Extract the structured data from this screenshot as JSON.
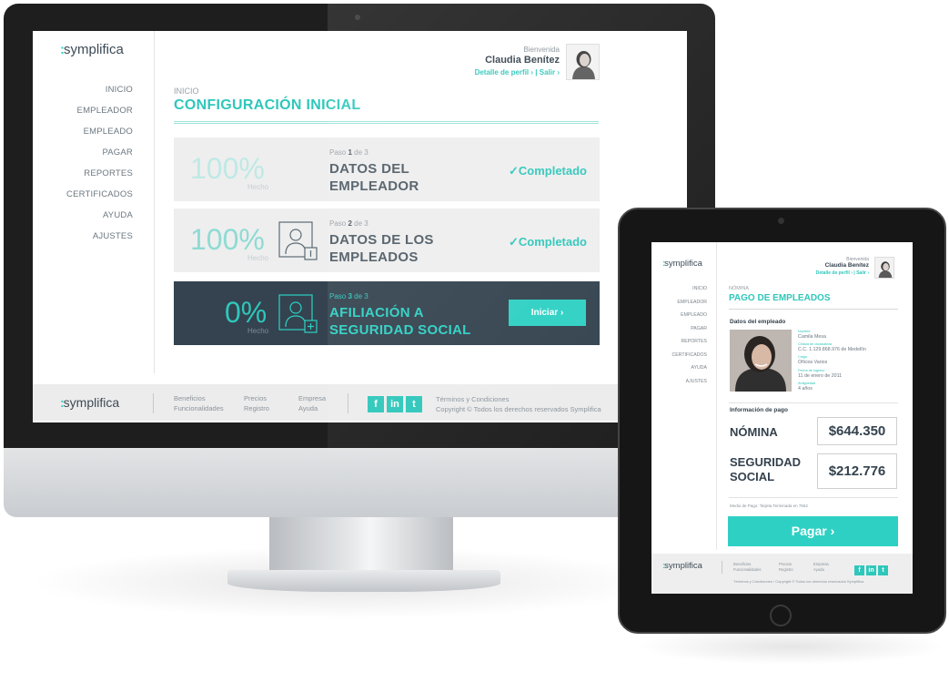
{
  "desktop": {
    "brand": {
      "dots": ":",
      "name": "symplifica"
    },
    "nav": [
      "INICIO",
      "EMPLEADOR",
      "EMPLEADO",
      "PAGAR",
      "REPORTES",
      "CERTIFICADOS",
      "AYUDA",
      "AJUSTES"
    ],
    "user": {
      "welcome": "Bienvenida",
      "name": "Claudia Benítez",
      "profile_link": "Detalle de perfil ›",
      "sep": "|",
      "logout_link": "Salir ›"
    },
    "breadcrumb": "INICIO",
    "page_title": "CONFIGURACIÓN INICIAL",
    "steps": [
      {
        "percent": "100%",
        "percent_label": "Hecho",
        "paso_prefix": "Paso",
        "paso_num": "1",
        "paso_suffix": "de 3",
        "name_line1": "DATOS DEL",
        "name_line2": "EMPLEADOR",
        "status": "✓Completado",
        "progress": 1.0
      },
      {
        "percent": "100%",
        "percent_label": "Hecho",
        "paso_prefix": "Paso",
        "paso_num": "2",
        "paso_suffix": "de 3",
        "name_line1": "DATOS DE LOS",
        "name_line2": "EMPLEADOS",
        "status": "✓Completado",
        "progress": 1.0
      },
      {
        "percent": "0%",
        "percent_label": "Hecho",
        "paso_prefix": "Paso",
        "paso_num": "3",
        "paso_suffix": "de 3",
        "name_line1": "AFILIACIÓN A",
        "name_line2": "SEGURIDAD SOCIAL",
        "button": "Iniciar ›",
        "progress": 0.0
      }
    ],
    "footer": {
      "col1": [
        "Beneficios",
        "Funcionalidades"
      ],
      "col2": [
        "Precios",
        "Registro"
      ],
      "col3": [
        "Empresa",
        "Ayuda"
      ],
      "social": [
        "f",
        "in",
        "t"
      ],
      "legal1": "Términos y Condiciones",
      "legal2": "Copyright © Todos los derechos reservados Symplifica"
    }
  },
  "tablet": {
    "brand": {
      "dots": ":",
      "name": "symplifica"
    },
    "nav": [
      "INICIO",
      "EMPLEADOR",
      "EMPLEADO",
      "PAGAR",
      "REPORTES",
      "CERTIFICADOS",
      "AYUDA",
      "AJUSTES"
    ],
    "user": {
      "welcome": "Bienvenida",
      "name": "Claudia Benítez",
      "profile_link": "Detalle de perfil ›",
      "sep": "|",
      "logout_link": "Salir ›"
    },
    "breadcrumb": "NÓMINA",
    "page_title": "PAGO DE EMPLEADOS",
    "employee_section": "Datos del empleado",
    "employee_fields": [
      {
        "label": "Nombre",
        "value": "Camila Mesa"
      },
      {
        "label": "Cédula de ciudadanía",
        "value": "C.C. 1.129.868.976 de Medellín"
      },
      {
        "label": "Cargo",
        "value": "Oficios Varios"
      },
      {
        "label": "Fecha de ingreso",
        "value": "11 de enero de 2011"
      },
      {
        "label": "Antigüedad",
        "value": "4 años"
      }
    ],
    "payment_section": "Información de pago",
    "payments": [
      {
        "label_line1": "NÓMINA",
        "label_line2": "",
        "amount": "$644.350"
      },
      {
        "label_line1": "SEGURIDAD",
        "label_line2": "SOCIAL",
        "amount": "$212.776"
      }
    ],
    "payment_method": "Medio de Pago: Tarjeta Terminada en 7562",
    "pay_button": "Pagar ›",
    "footer": {
      "col1": [
        "Beneficios",
        "Funcionalidades"
      ],
      "col2": [
        "Precios",
        "Registro"
      ],
      "col3": [
        "Empresa",
        "Ayuda"
      ],
      "social": [
        "f",
        "in",
        "t"
      ],
      "legal": "Términos y Condiciones  /  Copyright © Todos los derechos reservados Symplifica"
    }
  },
  "colors": {
    "accent": "#2fd0c4",
    "dark": "#34434f",
    "text": "#34424e",
    "muted": "#8a949b",
    "panel": "#eeeeee"
  },
  "icons": [
    "person-card-icon",
    "check-icon",
    "chevron-right-icon",
    "facebook-icon",
    "linkedin-icon",
    "twitter-icon"
  ]
}
